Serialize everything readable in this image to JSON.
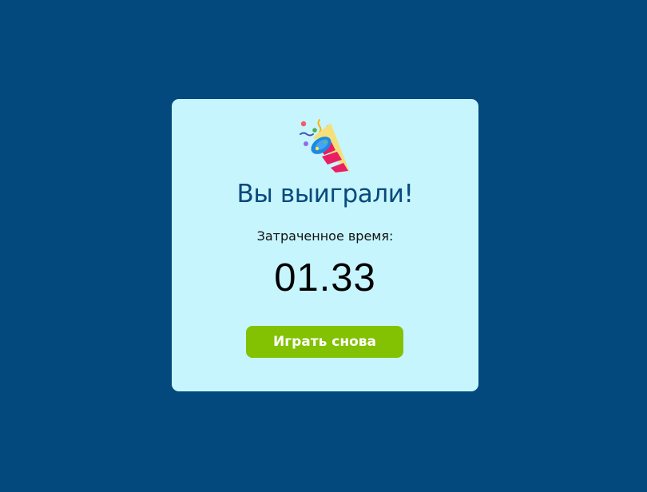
{
  "modal": {
    "icon": "party-popper-icon",
    "title": "Вы выиграли!",
    "time_label": "Затраченное время:",
    "time_value": "01.33",
    "play_again_label": "Играть снова"
  },
  "colors": {
    "background": "#03497d",
    "modal_background": "#c6f5fe",
    "title": "#094a7c",
    "button": "#83c103",
    "button_text": "#ffffff"
  }
}
